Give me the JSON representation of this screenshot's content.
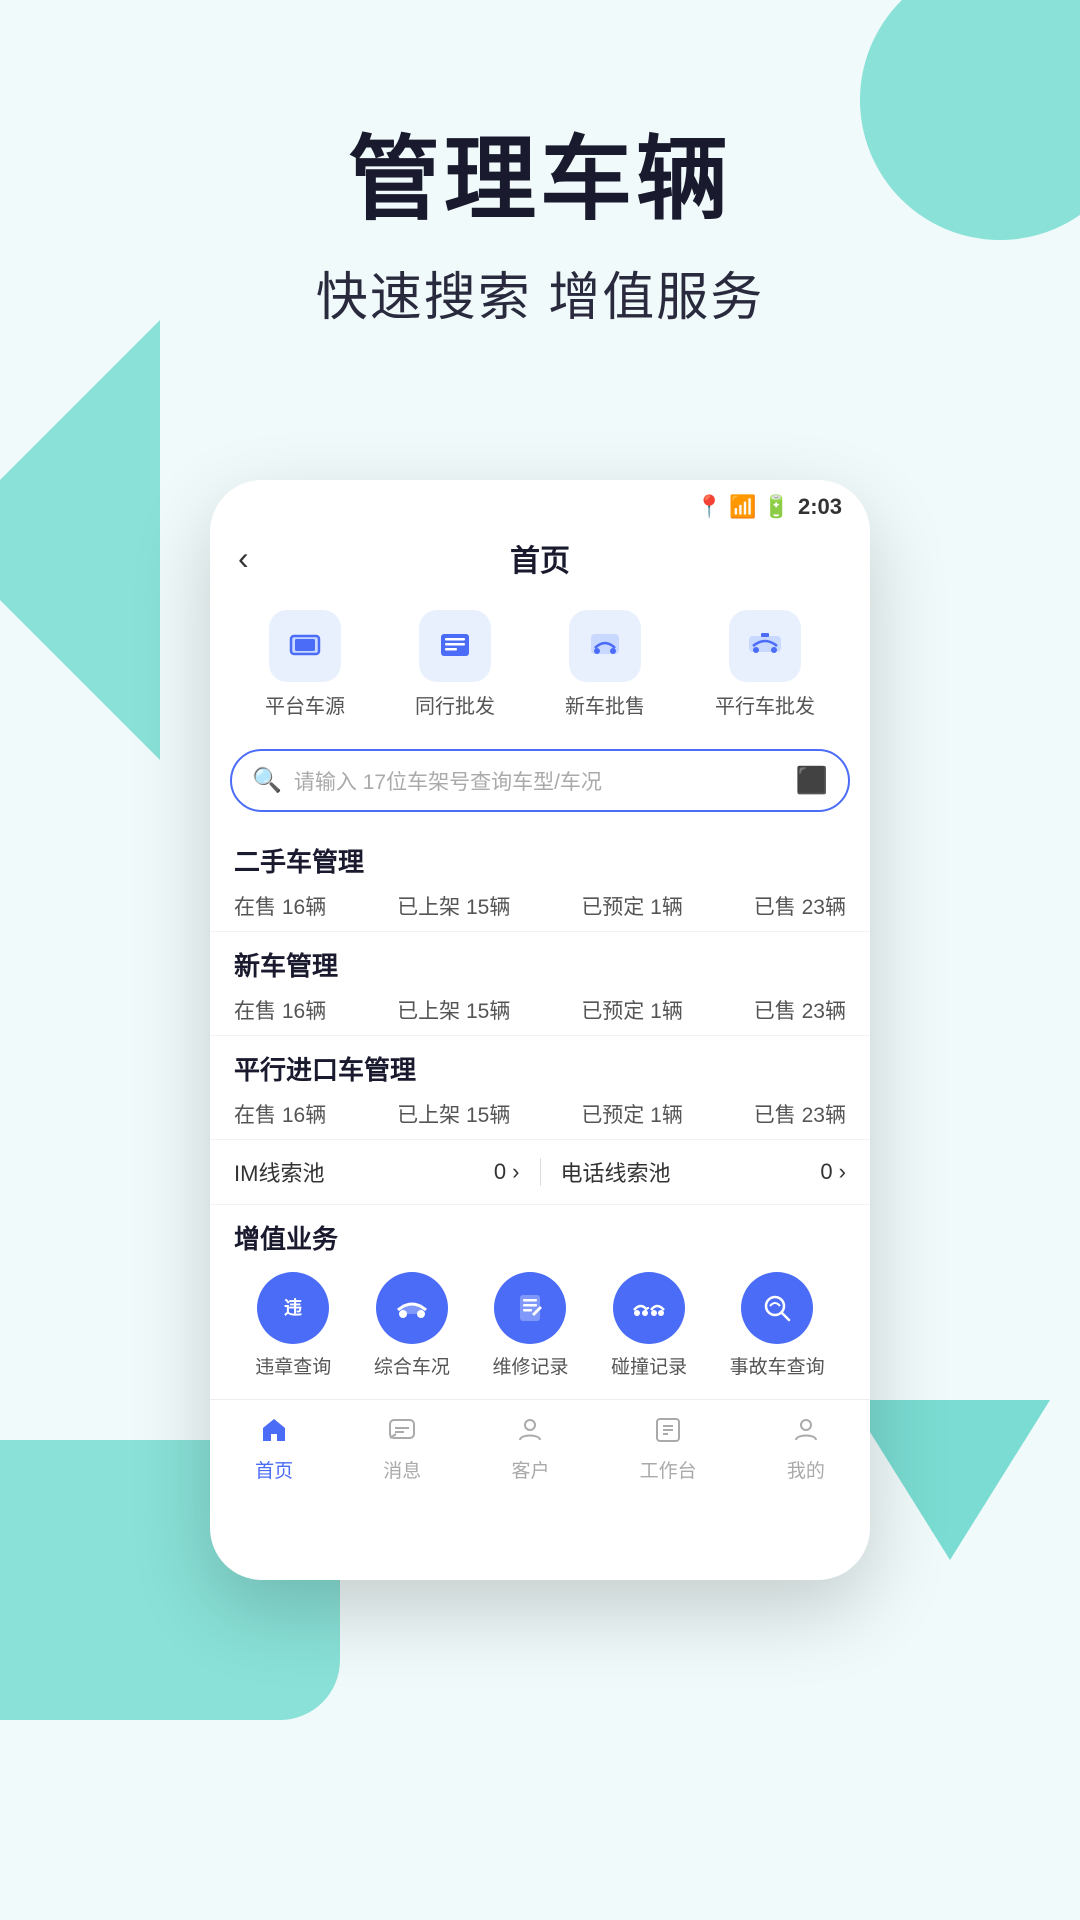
{
  "hero": {
    "title": "管理车辆",
    "subtitle": "快速搜索 增值服务"
  },
  "phone": {
    "status_bar": {
      "time": "2:03",
      "icons": [
        "location",
        "signal",
        "battery"
      ]
    },
    "nav": {
      "back_label": "‹",
      "title": "首页"
    },
    "quick_menu": [
      {
        "label": "平台车源",
        "icon": "🖥"
      },
      {
        "label": "同行批发",
        "icon": "📋"
      },
      {
        "label": "新车批售",
        "icon": "🚗"
      },
      {
        "label": "平行车批发",
        "icon": "🏎"
      }
    ],
    "search": {
      "placeholder": "请输入 17位车架号查询车型/车况"
    },
    "sections": [
      {
        "title": "二手车管理",
        "stats": [
          {
            "label": "在售",
            "value": "16辆"
          },
          {
            "label": "已上架",
            "value": "15辆"
          },
          {
            "label": "已预定",
            "value": "1辆"
          },
          {
            "label": "已售",
            "value": "23辆"
          }
        ]
      },
      {
        "title": "新车管理",
        "stats": [
          {
            "label": "在售",
            "value": "16辆"
          },
          {
            "label": "已上架",
            "value": "15辆"
          },
          {
            "label": "已预定",
            "value": "1辆"
          },
          {
            "label": "已售",
            "value": "23辆"
          }
        ]
      },
      {
        "title": "平行进口车管理",
        "stats": [
          {
            "label": "在售",
            "value": "16辆"
          },
          {
            "label": "已上架",
            "value": "15辆"
          },
          {
            "label": "已预定",
            "value": "1辆"
          },
          {
            "label": "已售",
            "value": "23辆"
          }
        ]
      }
    ],
    "lead_pools": [
      {
        "label": "IM线索池",
        "value": "0"
      },
      {
        "label": "电话线索池",
        "value": "0"
      }
    ],
    "value_added": {
      "title": "增值业务",
      "items": [
        {
          "label": "违章查询",
          "icon": "🚫"
        },
        {
          "label": "综合车况",
          "icon": "🚙"
        },
        {
          "label": "维修记录",
          "icon": "🔧"
        },
        {
          "label": "碰撞记录",
          "icon": "💥"
        },
        {
          "label": "事故车查询",
          "icon": "🔍"
        }
      ]
    },
    "tab_bar": [
      {
        "label": "首页",
        "icon": "🏠",
        "active": true
      },
      {
        "label": "消息",
        "icon": "💬",
        "active": false
      },
      {
        "label": "客户",
        "icon": "👤",
        "active": false
      },
      {
        "label": "工作台",
        "icon": "📋",
        "active": false
      },
      {
        "label": "我的",
        "icon": "👤",
        "active": false
      }
    ]
  }
}
